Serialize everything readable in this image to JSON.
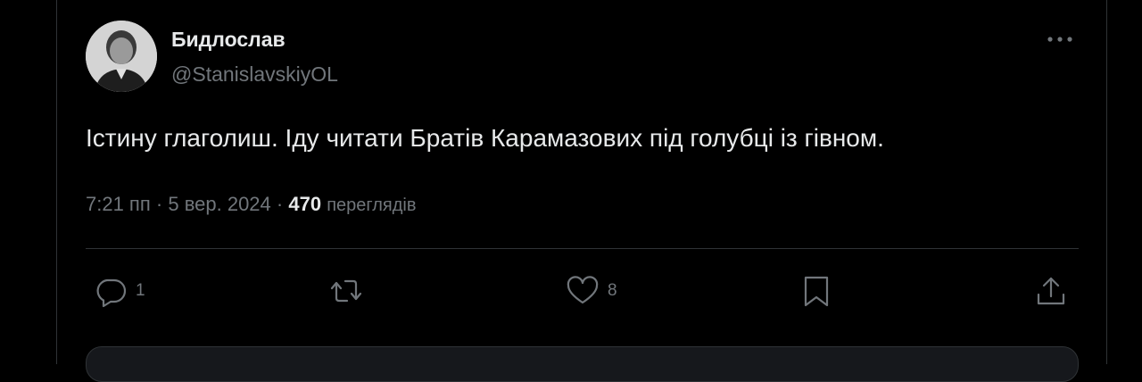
{
  "author": {
    "name": "Бидлослав",
    "handle": "@StanislavskiyOL"
  },
  "tweet": {
    "text": "Істину глаголиш. Іду читати Братів Карамазових під голубці із гівном."
  },
  "meta": {
    "time": "7:21 пп",
    "separator": "·",
    "date": "5 вер. 2024",
    "views_count": "470",
    "views_label": "переглядів"
  },
  "actions": {
    "reply_count": "1",
    "like_count": "8"
  },
  "icons": {
    "more": "more-horizontal-icon",
    "reply": "reply-bubble-icon",
    "retweet": "retweet-icon",
    "like": "heart-icon",
    "bookmark": "bookmark-icon",
    "share": "share-icon"
  },
  "colors": {
    "background": "#000000",
    "text": "#e7e9ea",
    "secondary": "#71767b",
    "border": "#2f3336"
  }
}
